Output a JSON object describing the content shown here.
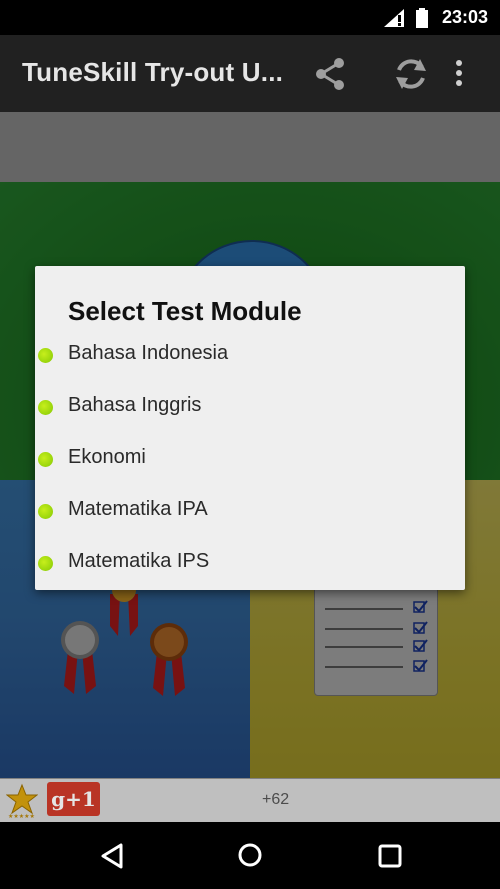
{
  "status_bar": {
    "time": "23:03"
  },
  "app_bar": {
    "title": "TuneSkill Try-out U...",
    "share_icon": "share-icon",
    "refresh_icon": "refresh-icon",
    "overflow_icon": "more-vert-icon"
  },
  "dialog": {
    "title": "Select Test Module",
    "items": [
      {
        "label": "Bahasa Indonesia"
      },
      {
        "label": "Bahasa Inggris"
      },
      {
        "label": "Ekonomi"
      },
      {
        "label": "Matematika IPA"
      },
      {
        "label": "Matematika IPS"
      }
    ],
    "bullet_color": "#9ad30f"
  },
  "bottom_bar": {
    "rating_icon": "star-icon",
    "gplus_label": "g+1",
    "gplus_count": "+62"
  },
  "colors": {
    "accent_green": "#9ad30f",
    "app_bar_bg": "#212121",
    "gplus_red": "#cf3a2a"
  },
  "nav_bar": {
    "back_icon": "back-icon",
    "home_icon": "home-icon",
    "recents_icon": "recents-icon"
  }
}
